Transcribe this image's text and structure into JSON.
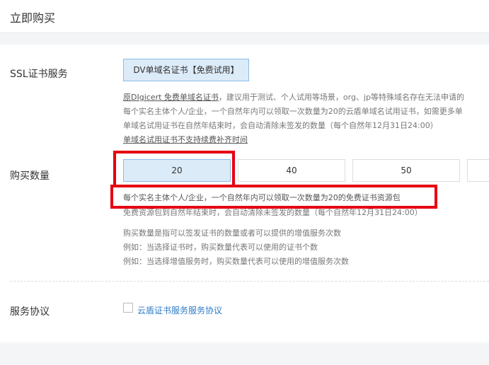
{
  "header": {
    "title": "立即购买"
  },
  "ssl": {
    "label": "SSL证书服务",
    "product_button": "DV单域名证书【免费试用】",
    "line1_link": "原DIgicert 免费单域名证书",
    "line1_rest": "，建议用于测试、个人试用等场景，org、jp等特殊域名存在无法申请的",
    "line2": "每个实名主体个人/企业，一个自然年内可以领取一次数量为20的云盾单域名试用证书，如需更多单",
    "line3": "单域名试用证书在自然年结束时，会自动清除未签发的数量（每个自然年12月31日24:00）",
    "line4_link": "单域名试用证书不支持续费补齐时间"
  },
  "quantity": {
    "label": "购买数量",
    "options": [
      "20",
      "40",
      "50"
    ],
    "selected": "20",
    "note1": "每个实名主体个人/企业，一个自然年内可以领取一次数量为20的免费证书资源包",
    "note2": "免费资源包到自然年结束时，会自动清除未签发的数量（每个自然年12月31日24:00）",
    "info1": "购买数量是指可以签发证书的数量或者可以提供的增值服务次数",
    "info2": "例如：当选择证书时，购买数量代表可以使用的证书个数",
    "info3": "例如：当选择增值服务时，购买数量代表可以使用的增值服务次数"
  },
  "agreement": {
    "label": "服务协议",
    "link": "云盾证书服务服务协议",
    "checked": false
  },
  "colors": {
    "accent": "#2f7cc7",
    "selected_bg": "#dcebf8",
    "highlight": "#e60012"
  }
}
